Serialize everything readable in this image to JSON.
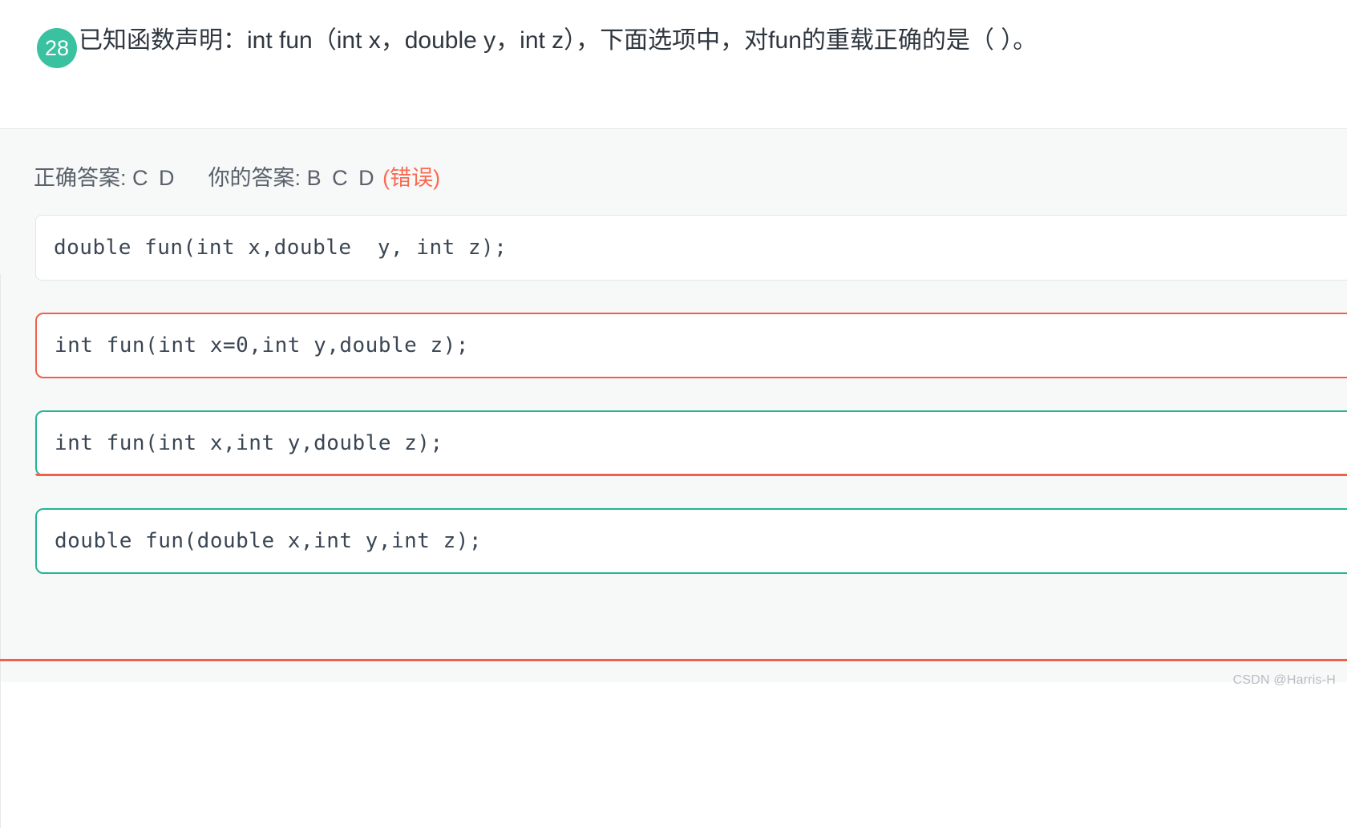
{
  "question": {
    "number": "28",
    "text": "已知函数声明：int fun（int x，double y，int z），下面选项中，对fun的重载正确的是（  ）。"
  },
  "answer_summary": {
    "correct_label": "正确答案:",
    "correct_value": "C D",
    "your_label": "你的答案:",
    "your_value": "B C D",
    "result": "(错误)",
    "result_color": "#fa6a51"
  },
  "options": [
    {
      "key": "A",
      "code": "double fun(int x,double  y, int z);",
      "state": "neutral"
    },
    {
      "key": "B",
      "code": "int fun(int x=0,int y,double z);",
      "state": "wrong"
    },
    {
      "key": "C",
      "code": "int fun(int x,int y,double z);",
      "state": "correct-wrongmark"
    },
    {
      "key": "D",
      "code": "double fun(double x,int y,int z);",
      "state": "correct"
    }
  ],
  "watermark": "CSDN @Harris-H",
  "colors": {
    "badge_green": "#3ac1a0",
    "correct_green": "#22b596",
    "wrong_red": "#f0604a",
    "panel_bg": "#f7f8f8"
  }
}
